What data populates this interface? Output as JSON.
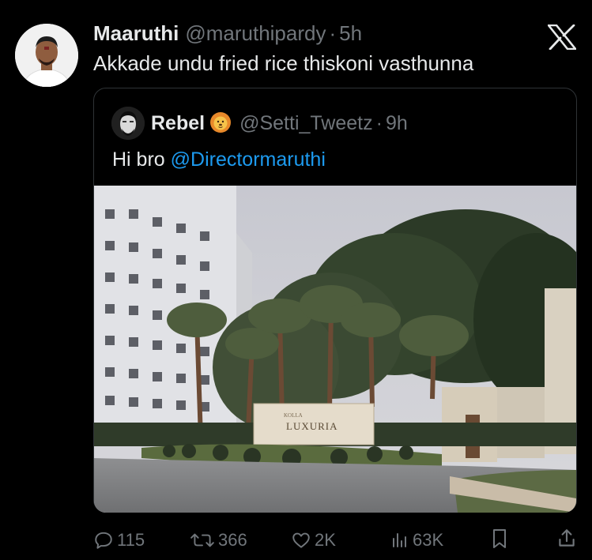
{
  "post": {
    "author_name": "Maaruthi",
    "author_handle": "@maruthipardy",
    "separator": "·",
    "time": "5h",
    "text": "Akkade undu fried rice thiskoni vasthunna"
  },
  "quote": {
    "author_name": "Rebel",
    "author_emoji_icon": "lion-face-icon",
    "author_handle": "@Setti_Tweetz",
    "separator": "·",
    "time": "9h",
    "text_prefix": "Hi bro ",
    "mention": "@Directormaruthi",
    "photo_sign_small": "KOLLA",
    "photo_sign_large": "LUXURIA"
  },
  "actions": {
    "replies": "115",
    "reposts": "366",
    "likes": "2K",
    "views": "63K"
  },
  "icons": {
    "close": "x-logo-icon",
    "reply": "reply-icon",
    "repost": "repost-icon",
    "like": "heart-icon",
    "views": "views-icon",
    "bookmark": "bookmark-icon",
    "share": "share-icon"
  },
  "colors": {
    "background": "#000000",
    "text": "#e7e9ea",
    "muted": "#71767b",
    "link": "#1d9bf0",
    "border": "#2f3336"
  }
}
